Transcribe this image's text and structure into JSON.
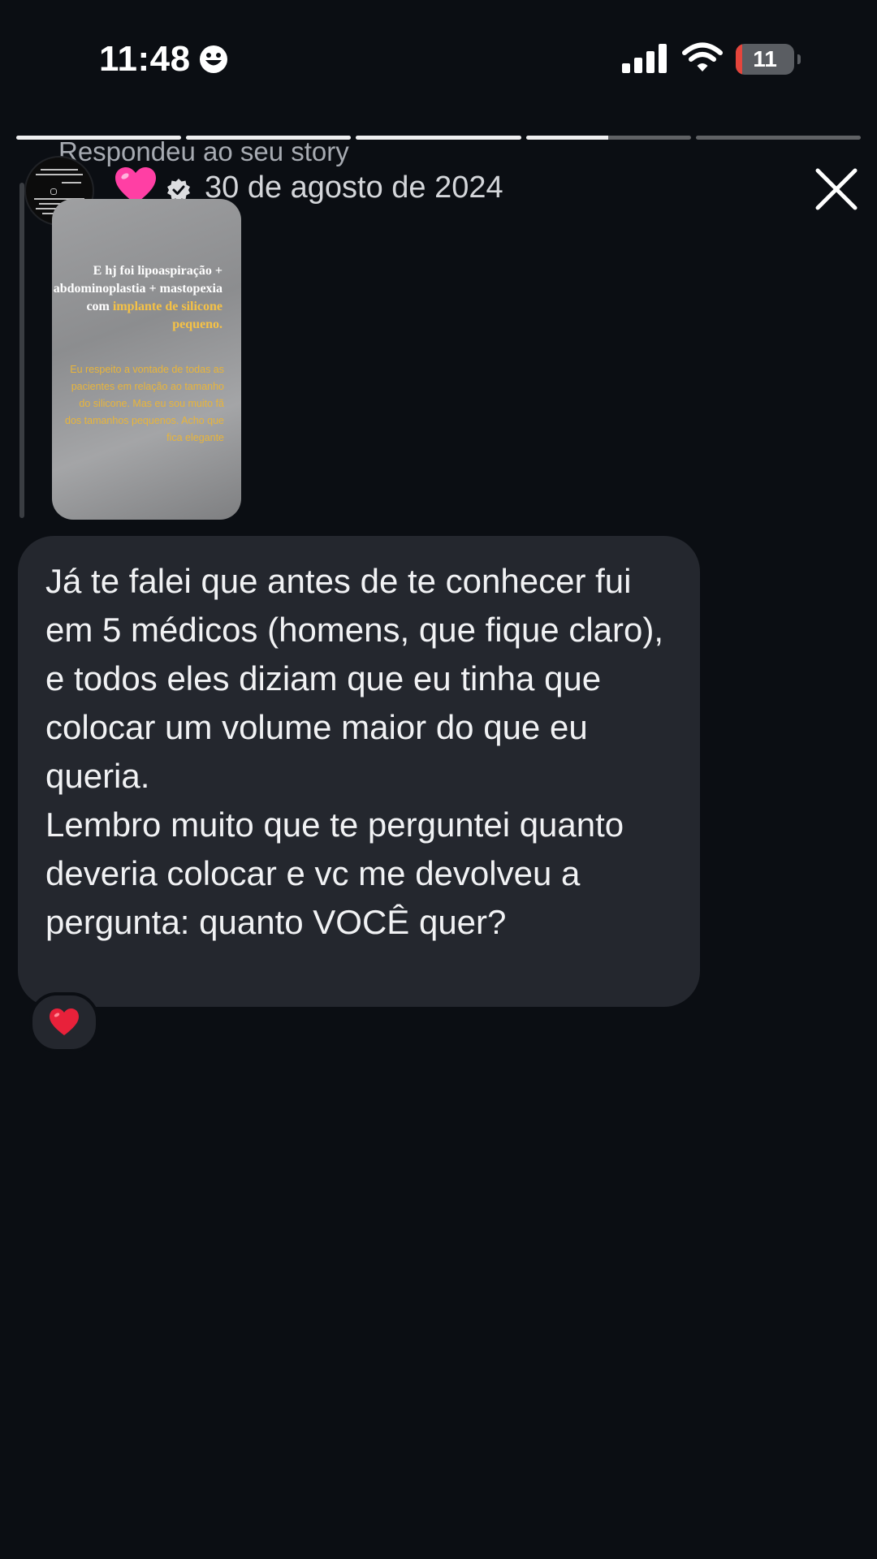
{
  "status_bar": {
    "time": "11:48",
    "battery_level": "11",
    "battery_fraction": 0.11,
    "icons": [
      "smiley-icon",
      "cellular-signal-icon",
      "wifi-icon",
      "battery-icon"
    ]
  },
  "story": {
    "segments": [
      1,
      1,
      1,
      0.5,
      0
    ],
    "replied_label": "Respondeu ao seu story",
    "reaction_emoji": "pink-heart-icon",
    "date": "30 de agosto de 2024",
    "close_icon": "close-icon",
    "thumbnail": {
      "heading_plain": "E hj foi lipoaspiração + abdominoplastia + mastopexia com",
      "heading_highlight": "implante de silicone pequeno.",
      "body": "Eu respeito a vontade de todas as pacientes em relação ao tamanho do silicone. Mas eu sou muito fã dos tamanhos pequenos. Acho que fica elegante"
    }
  },
  "message": {
    "paragraph1": "Já te falei que antes de te conhecer fui em 5 médicos (homens, que fique claro), e todos eles diziam que eu tinha que colocar um volume maior do que eu queria.",
    "paragraph2": "Lembro muito que te perguntei quanto deveria colocar e vc me devolveu a pergunta: quanto VOCÊ quer?",
    "reaction": "red-heart-icon"
  },
  "colors": {
    "background": "#0b0e13",
    "bubble": "#24272e",
    "highlight": "#f6c245",
    "battery_low": "#e5453c"
  }
}
